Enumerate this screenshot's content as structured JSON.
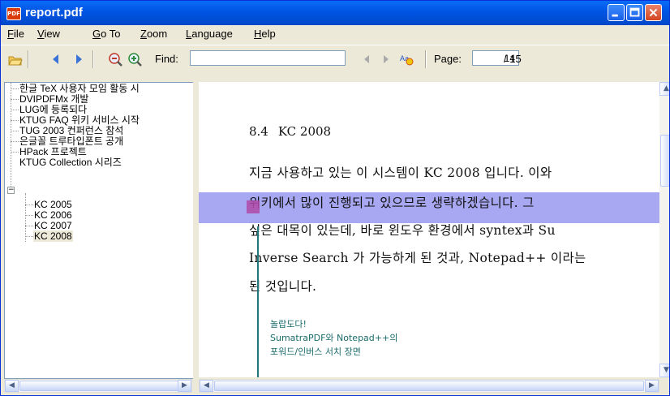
{
  "window": {
    "title": "report.pdf",
    "app_icon_label": "PDF"
  },
  "menu": [
    {
      "key": "F",
      "rest": "ile"
    },
    {
      "key": "V",
      "rest": "iew"
    },
    {
      "key": "G",
      "rest": "o To"
    },
    {
      "key": "Z",
      "rest": "oom"
    },
    {
      "key": "L",
      "rest": "anguage"
    },
    {
      "key": "H",
      "rest": "elp"
    }
  ],
  "toolbar": {
    "find_label": "Find:",
    "find_value": "",
    "page_label": "Page:",
    "page_value": "14",
    "page_total": "/ 15"
  },
  "toc": [
    {
      "label": "한글 TeX 사용자 모임 활동 시",
      "level": 0
    },
    {
      "label": "DVIPDFMx 개발",
      "level": 0
    },
    {
      "label": "LUG에 등록되다",
      "level": 0
    },
    {
      "label": "KTUG FAQ 위키 서비스 시작",
      "level": 0
    },
    {
      "label": "TUG 2003 컨퍼런스 참석",
      "level": 0
    },
    {
      "label": "은글꼴 트루타입폰트 공개",
      "level": 0
    },
    {
      "label": "HPack 프로젝트",
      "level": 0
    },
    {
      "label": "KTUG Collection 시리즈",
      "level": 0,
      "expander": "−"
    },
    {
      "label": "KC 2005",
      "level": 1
    },
    {
      "label": "KC 2006",
      "level": 1
    },
    {
      "label": "KC 2007",
      "level": 1
    },
    {
      "label": "KC 2008",
      "level": 1,
      "selected": true
    }
  ],
  "document": {
    "heading_num": "8.4",
    "heading_text": "KC 2008",
    "lines": [
      "지금 사용하고 있는 이 시스템이 KC 2008 입니다. 이와",
      "위키에서 많이 진행되고 있으므로 생략하겠습니다. 그",
      "싶은 대목이 있는데, 바로 윈도우 환경에서 syntex과 Su",
      "Inverse Search 가 가능하게 된 것과, Notepad++ 이라는",
      "된 것입니다."
    ],
    "annotation": [
      "놀랍도다!",
      "SumatraPDF와 Notepad++의",
      "포워드/인버스 서치 장면"
    ]
  }
}
